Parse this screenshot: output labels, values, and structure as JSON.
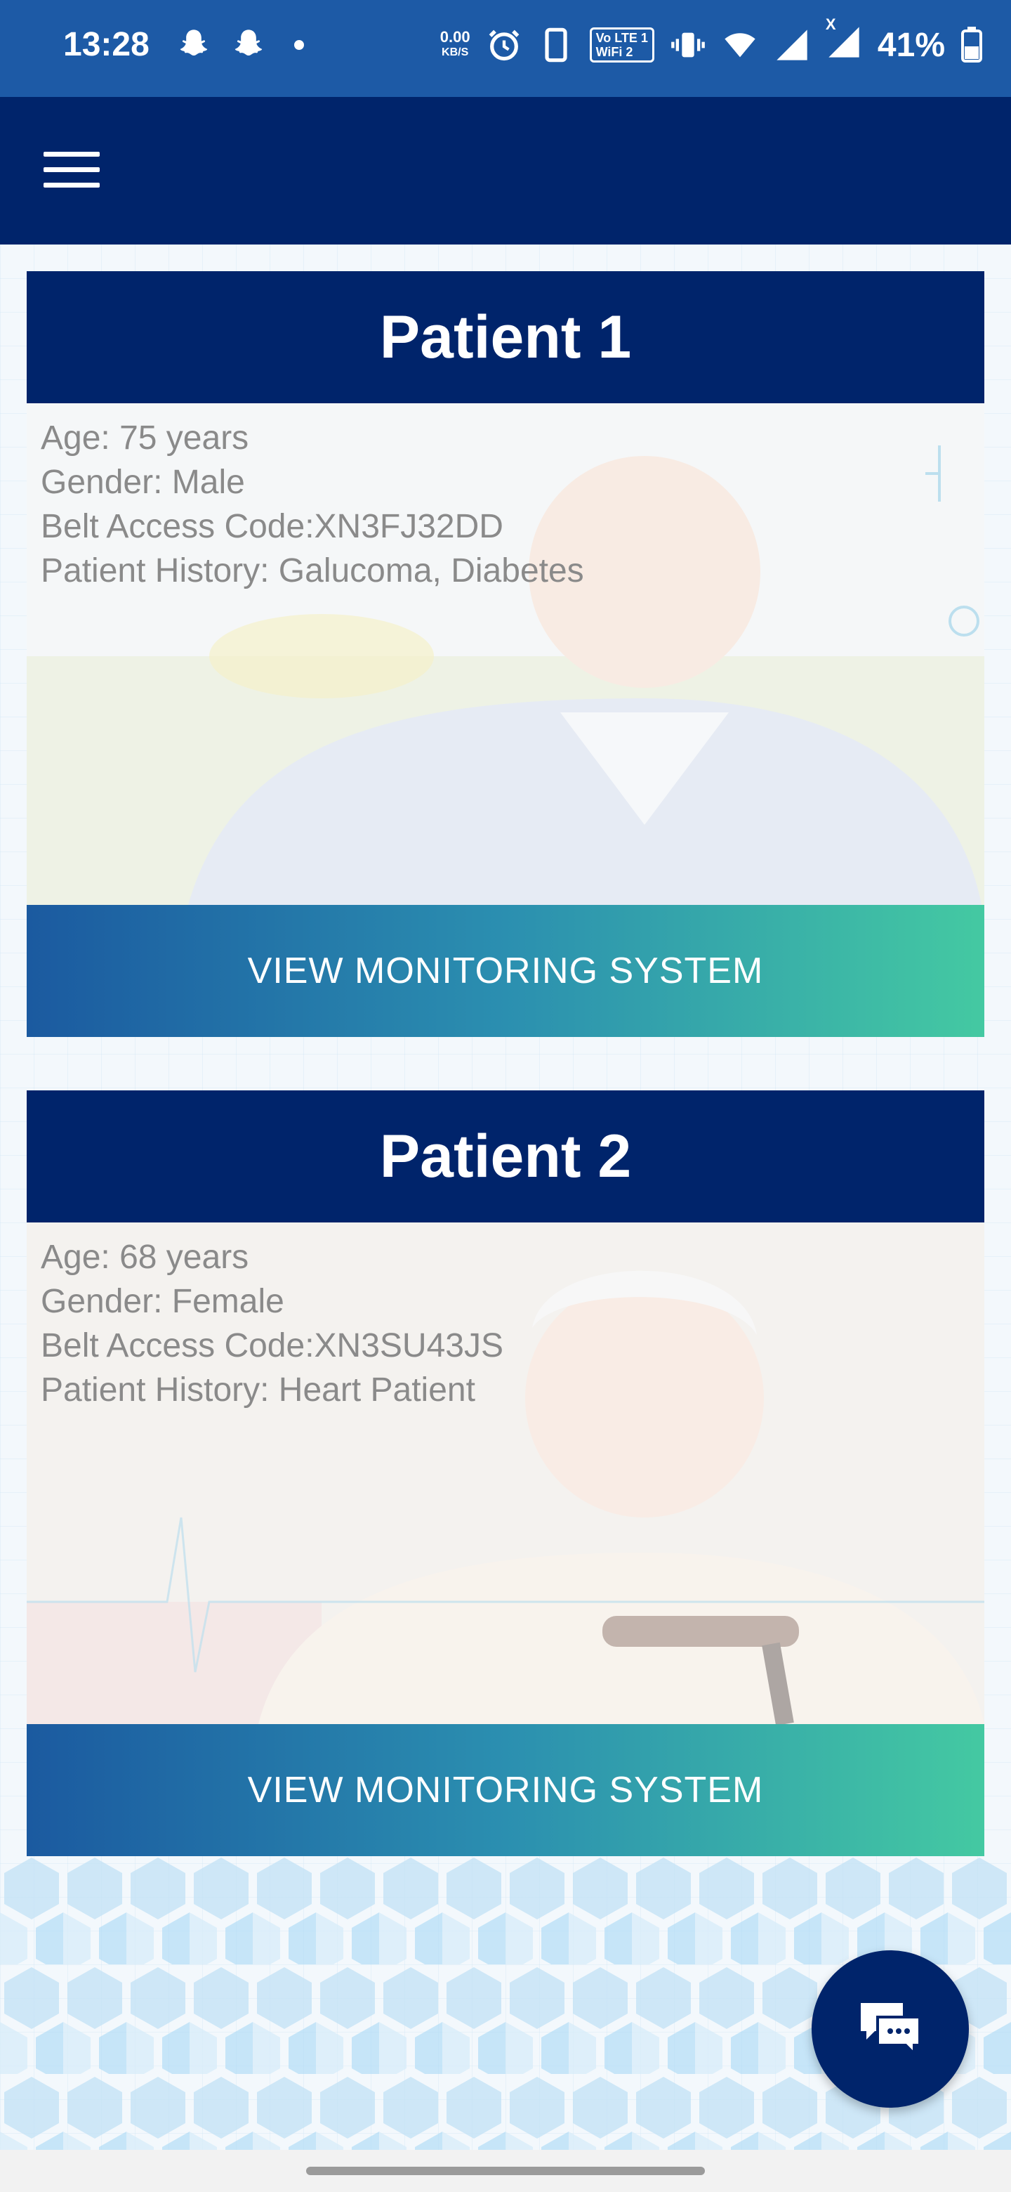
{
  "status_bar": {
    "time": "13:28",
    "net_speed_value": "0.00",
    "net_speed_unit": "KB/S",
    "volte_line1": "Vo LTE 1",
    "volte_line2": "WiFi 2",
    "lte_label": "X",
    "battery": "41%",
    "icons": [
      "snapchat-icon",
      "snapchat-icon",
      "dot-icon",
      "alarm-icon",
      "phone-icon",
      "vibrate-icon",
      "wifi-icon",
      "signal-icon",
      "signal-icon",
      "battery-icon"
    ]
  },
  "app_bar": {
    "menu_icon": "hamburger-menu-icon"
  },
  "patients": [
    {
      "title": "Patient 1",
      "age": "Age: 75 years",
      "gender": "Gender: Male",
      "belt_code": "Belt Access Code:XN3FJ32DD",
      "history": "Patient History: Galucoma, Diabetes",
      "button": "VIEW MONITORING SYSTEM"
    },
    {
      "title": "Patient 2",
      "age": "Age: 68 years",
      "gender": "Gender: Female",
      "belt_code": "Belt Access Code:XN3SU43JS",
      "history": "Patient History: Heart Patient",
      "button": "VIEW MONITORING SYSTEM"
    }
  ],
  "chat_button": {
    "icon": "chat-bubble-icon"
  },
  "colors": {
    "status_bar": "#1d5aa6",
    "app_bar": "#00246b",
    "card_header": "#00246b",
    "button_start": "#1b5aa0",
    "button_end": "#44c9a2",
    "info_text": "#8a8a8a"
  }
}
